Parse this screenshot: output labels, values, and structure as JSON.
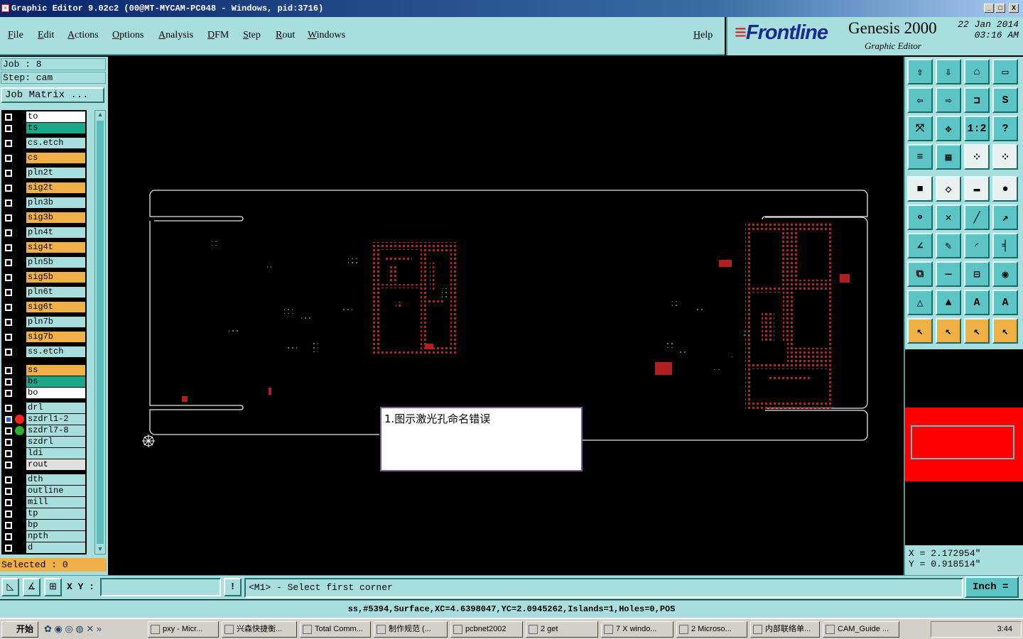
{
  "window": {
    "title": "Graphic Editor 9.02c2  (00@MT-MYCAM-PC048 - Windows, pid:3716)",
    "minimize": "_",
    "maximize": "□",
    "close": "X"
  },
  "menu": {
    "items": [
      "File",
      "Edit",
      "Actions",
      "Options",
      "Analysis",
      "DFM",
      "Step",
      "Rout",
      "Windows"
    ],
    "help": "Help"
  },
  "brand": {
    "logo_prefix": "F",
    "logo": "rontline",
    "product": "Genesis 2000",
    "subtitle": "Graphic Editor",
    "date_line1": "22 Jan 2014",
    "date_line2": "03:16 AM"
  },
  "job": {
    "job_label": "Job : 8",
    "step_label": "Step: cam",
    "matrix_button": "Job Matrix ..."
  },
  "layers": [
    {
      "name": "to",
      "color": "#ffffff",
      "dot": ""
    },
    {
      "name": "ts",
      "color": "#1aa88a",
      "dot": ""
    },
    {
      "name": "cs.etch",
      "color": "#a8dede",
      "dot": ""
    },
    {
      "name": "cs",
      "color": "#f0b048",
      "dot": ""
    },
    {
      "name": "pln2t",
      "color": "#a8dede",
      "dot": ""
    },
    {
      "name": "sig2t",
      "color": "#f0b048",
      "dot": ""
    },
    {
      "name": "pln3b",
      "color": "#a8dede",
      "dot": ""
    },
    {
      "name": "sig3b",
      "color": "#f0b048",
      "dot": ""
    },
    {
      "name": "pln4t",
      "color": "#a8dede",
      "dot": ""
    },
    {
      "name": "sig4t",
      "color": "#f0b048",
      "dot": ""
    },
    {
      "name": "pln5b",
      "color": "#a8dede",
      "dot": ""
    },
    {
      "name": "sig5b",
      "color": "#f0b048",
      "dot": ""
    },
    {
      "name": "pln6t",
      "color": "#a8dede",
      "dot": ""
    },
    {
      "name": "sig6t",
      "color": "#f0b048",
      "dot": ""
    },
    {
      "name": "pln7b",
      "color": "#a8dede",
      "dot": ""
    },
    {
      "name": "sig7b",
      "color": "#f0b048",
      "dot": ""
    },
    {
      "name": "ss.etch",
      "color": "#a8dede",
      "dot": ""
    },
    {
      "name": "ss",
      "color": "#f0b048",
      "dot": ""
    },
    {
      "name": "bs",
      "color": "#1aa88a",
      "dot": ""
    },
    {
      "name": "bo",
      "color": "#ffffff",
      "dot": ""
    },
    {
      "name": "drl",
      "color": "#a8dede",
      "dot": ""
    },
    {
      "name": "szdrl1-2",
      "color": "#a8dede",
      "dot": "#ff2020",
      "selected": true,
      "mark": "m"
    },
    {
      "name": "szdrl7-8",
      "color": "#a8dede",
      "dot": "#30b030"
    },
    {
      "name": "szdrl",
      "color": "#a8dede",
      "dot": ""
    },
    {
      "name": "ldi",
      "color": "#a8dede",
      "dot": ""
    },
    {
      "name": "rout",
      "color": "#e0e0e0",
      "dot": ""
    },
    {
      "name": "dth",
      "color": "#a8dede",
      "dot": ""
    },
    {
      "name": "outline",
      "color": "#a8dede",
      "dot": ""
    },
    {
      "name": "mill",
      "color": "#a8dede",
      "dot": ""
    },
    {
      "name": "tp",
      "color": "#a8dede",
      "dot": ""
    },
    {
      "name": "bp",
      "color": "#a8dede",
      "dot": ""
    },
    {
      "name": "npth",
      "color": "#a8dede",
      "dot": ""
    },
    {
      "name": "d",
      "color": "#a8dede",
      "dot": ""
    }
  ],
  "selected": "Selected : 0",
  "popup": {
    "text": "1.图示激光孔命名错误"
  },
  "toolbar": {
    "tools": [
      {
        "name": "pan-up-icon",
        "glyph": "⇧",
        "style": ""
      },
      {
        "name": "pan-down-icon",
        "glyph": "⇩",
        "style": ""
      },
      {
        "name": "home-icon",
        "glyph": "⌂",
        "style": ""
      },
      {
        "name": "zoom-window-icon",
        "glyph": "▭",
        "style": ""
      },
      {
        "name": "pan-left-icon",
        "glyph": "⇦",
        "style": ""
      },
      {
        "name": "pan-right-icon",
        "glyph": "⇨",
        "style": ""
      },
      {
        "name": "zoom-toggle-icon",
        "glyph": "⊐",
        "style": ""
      },
      {
        "name": "redraw-icon",
        "glyph": "S",
        "style": ""
      },
      {
        "name": "fit-icon",
        "glyph": "⤧",
        "style": ""
      },
      {
        "name": "zoom-home-icon",
        "glyph": "✥",
        "style": ""
      },
      {
        "name": "scale-1-2-icon",
        "glyph": "1:2",
        "style": ""
      },
      {
        "name": "help-icon",
        "glyph": "?",
        "style": ""
      },
      {
        "name": "snap-icon",
        "glyph": "≡",
        "style": ""
      },
      {
        "name": "grid-icon",
        "glyph": "▦",
        "style": ""
      },
      {
        "name": "net-icon",
        "glyph": "⁘",
        "style": "white"
      },
      {
        "name": "net2-icon",
        "glyph": "⁘",
        "style": "white"
      },
      {
        "name": "fill-icon",
        "glyph": "■",
        "style": "white"
      },
      {
        "name": "eraser-icon",
        "glyph": "◇",
        "style": "white"
      },
      {
        "name": "ruler-icon",
        "glyph": "▬",
        "style": "white"
      },
      {
        "name": "pad-icon",
        "glyph": "●",
        "style": "white"
      },
      {
        "name": "nodes-icon",
        "glyph": "⚬",
        "style": ""
      },
      {
        "name": "cross-icon",
        "glyph": "✕",
        "style": ""
      },
      {
        "name": "line-icon",
        "glyph": "╱",
        "style": ""
      },
      {
        "name": "arrow-line-icon",
        "glyph": "↗",
        "style": ""
      },
      {
        "name": "angle-icon",
        "glyph": "∠",
        "style": ""
      },
      {
        "name": "pen-icon",
        "glyph": "✎",
        "style": ""
      },
      {
        "name": "arc-icon",
        "glyph": "◜",
        "style": ""
      },
      {
        "name": "mirror-icon",
        "glyph": "╡",
        "style": ""
      },
      {
        "name": "copy-icon",
        "glyph": "⧉",
        "style": ""
      },
      {
        "name": "minus-icon",
        "glyph": "—",
        "style": ""
      },
      {
        "name": "measure-icon",
        "glyph": "⊟",
        "style": ""
      },
      {
        "name": "shapes-icon",
        "glyph": "◉",
        "style": ""
      },
      {
        "name": "triangle-icon",
        "glyph": "△",
        "style": ""
      },
      {
        "name": "triangle2-icon",
        "glyph": "▲",
        "style": ""
      },
      {
        "name": "arch-icon",
        "glyph": "A",
        "style": ""
      },
      {
        "name": "arch2-icon",
        "glyph": "A",
        "style": ""
      },
      {
        "name": "select-icon",
        "glyph": "↖",
        "style": "gold"
      },
      {
        "name": "select2-icon",
        "glyph": "↖",
        "style": "gold"
      },
      {
        "name": "select3-icon",
        "glyph": "↖",
        "style": "gold"
      },
      {
        "name": "select4-icon",
        "glyph": "↖",
        "style": "gold"
      }
    ]
  },
  "coords": {
    "x": "X = 2.172954\"",
    "y": "Y = 0.918514\""
  },
  "command": {
    "xy_label": "X Y :",
    "xy_value": "",
    "prompt": "<M1> - Select first corner",
    "units": "Inch ="
  },
  "feature_line": "ss,#5394,Surface,XC=4.6398047,YC=2.0945262,Islands=1,Holes=0,POS",
  "taskbar": {
    "start": "开始",
    "items": [
      "pxy - Micr...",
      "兴森快捷衡...",
      "Total Comm...",
      "制作规范 (...",
      "pcbnet2002",
      "2 get",
      "7 X windo...",
      "2 Microso...",
      "内部联络单...",
      "CAM_Guide ..."
    ],
    "clock": "3:44"
  },
  "colors": {
    "panel": "#a8dede",
    "accent": "#f0b048",
    "red": "#d01818",
    "green": "#3a8a3a"
  }
}
